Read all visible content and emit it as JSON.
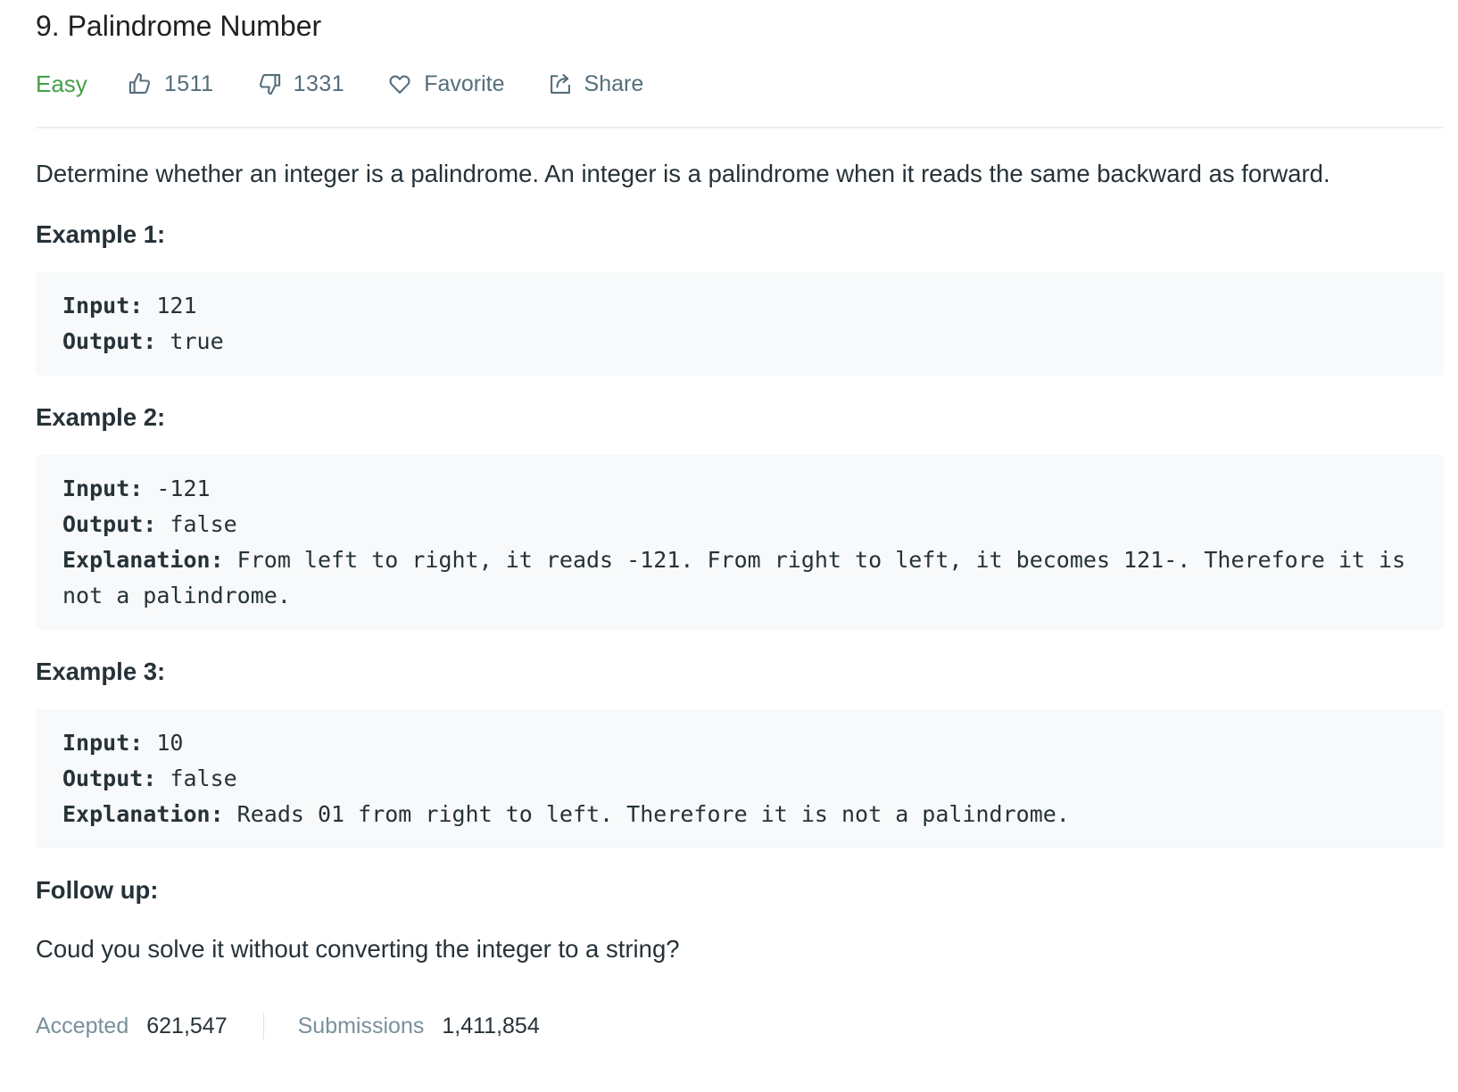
{
  "problem": {
    "title": "9. Palindrome Number",
    "difficulty": "Easy",
    "likes": "1511",
    "dislikes": "1331",
    "favorite_label": "Favorite",
    "share_label": "Share",
    "description": "Determine whether an integer is a palindrome. An integer is a palindrome when it reads the same backward as forward."
  },
  "examples": [
    {
      "heading": "Example 1:",
      "input_label": "Input:",
      "input_value": " 121",
      "output_label": "Output:",
      "output_value": " true"
    },
    {
      "heading": "Example 2:",
      "input_label": "Input:",
      "input_value": " -121",
      "output_label": "Output:",
      "output_value": " false",
      "explanation_label": "Explanation:",
      "explanation_value": " From left to right, it reads -121. From right to left, it becomes 121-. Therefore it is not a palindrome."
    },
    {
      "heading": "Example 3:",
      "input_label": "Input:",
      "input_value": " 10",
      "output_label": "Output:",
      "output_value": " false",
      "explanation_label": "Explanation:",
      "explanation_value": " Reads 01 from right to left. Therefore it is not a palindrome."
    }
  ],
  "followup": {
    "heading": "Follow up:",
    "text": "Coud you solve it without converting the integer to a string?"
  },
  "stats": {
    "accepted_label": "Accepted",
    "accepted_value": "621,547",
    "submissions_label": "Submissions",
    "submissions_value": "1,411,854"
  },
  "colors": {
    "difficulty_easy": "#43a047",
    "code_background": "#f7f9fa",
    "muted_text": "#546e7a"
  },
  "icons": {
    "like": "thumbs-up-icon",
    "dislike": "thumbs-down-icon",
    "favorite": "heart-icon",
    "share": "share-icon"
  }
}
